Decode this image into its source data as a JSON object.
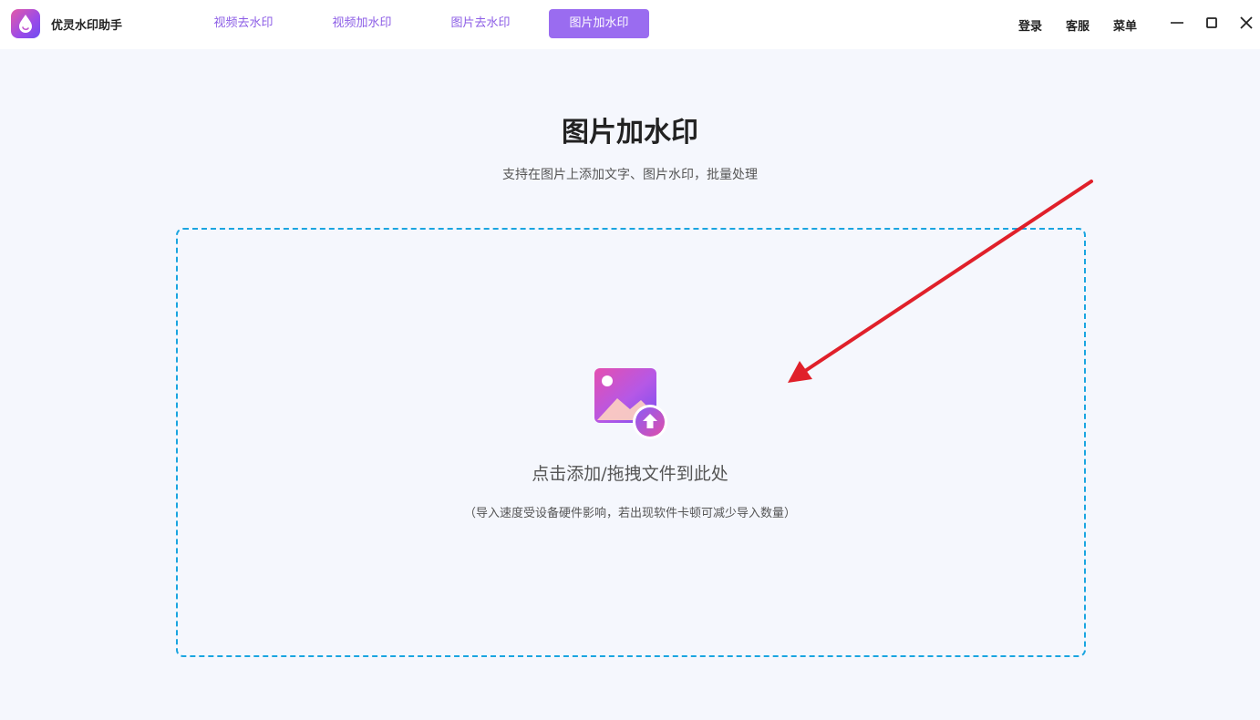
{
  "app": {
    "name": "优灵水印助手",
    "icon": "water-drop-logo-icon",
    "accent_color": "#9a6cf0"
  },
  "tabs": [
    {
      "label": "视频去水印",
      "active": false
    },
    {
      "label": "视频加水印",
      "active": false
    },
    {
      "label": "图片去水印",
      "active": false
    },
    {
      "label": "图片加水印",
      "active": true
    }
  ],
  "header_links": {
    "login": "登录",
    "service": "客服",
    "menu": "菜单"
  },
  "window_controls": [
    "minimize-icon",
    "maximize-icon",
    "close-icon"
  ],
  "main": {
    "title": "图片加水印",
    "subtitle": "支持在图片上添加文字、图片水印，批量处理",
    "dropzone": {
      "icon": "image-upload-icon",
      "label": "点击添加/拖拽文件到此处",
      "hint": "（导入速度受设备硬件影响，若出现软件卡顿可减少导入数量）",
      "border_color": "#1aa5e0"
    }
  },
  "annotation": {
    "type": "red-arrow",
    "color": "#e0202a"
  }
}
